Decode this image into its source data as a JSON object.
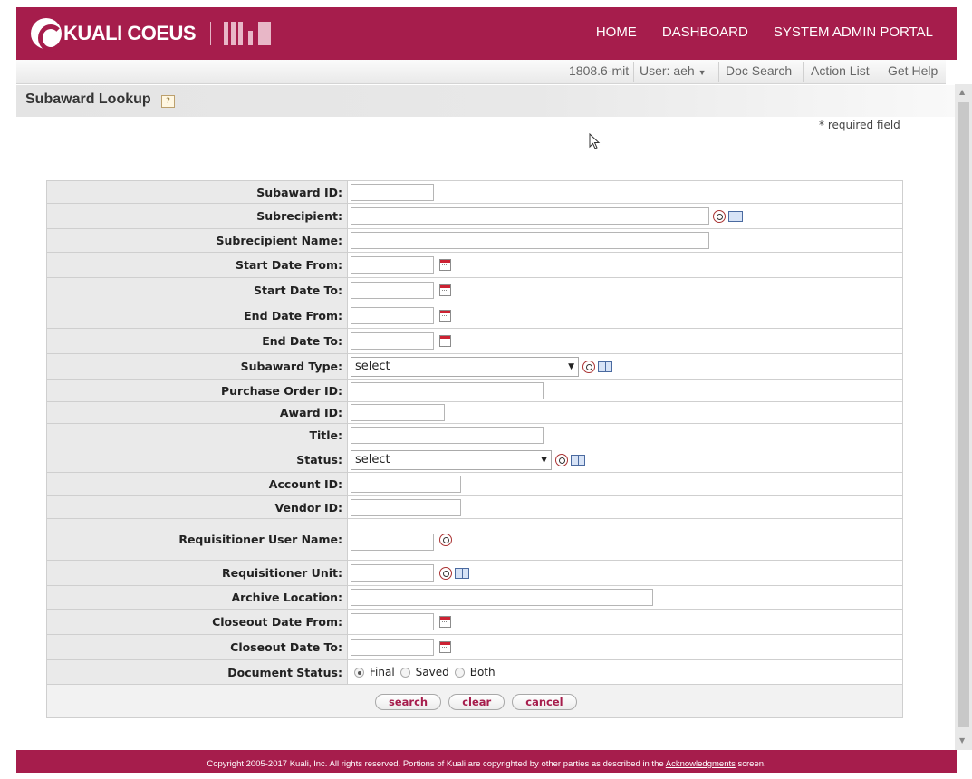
{
  "header": {
    "logo_text": "KUALI COEUS",
    "nav": [
      "HOME",
      "DASHBOARD",
      "SYSTEM ADMIN PORTAL"
    ]
  },
  "subbar": {
    "version": "1808.6-mit",
    "user_label": "User: aeh",
    "items": [
      "Doc Search",
      "Action List",
      "Get Help"
    ]
  },
  "page": {
    "title": "Subaward Lookup",
    "help_icon": "?",
    "required_note": "* required field"
  },
  "form": {
    "subaward_id": "Subaward ID:",
    "subrecipient": "Subrecipient:",
    "subrecipient_name": "Subrecipient Name:",
    "start_date_from": "Start Date From:",
    "start_date_to": "Start Date To:",
    "end_date_from": "End Date From:",
    "end_date_to": "End Date To:",
    "subaward_type": "Subaward Type:",
    "subaward_type_value": "select",
    "purchase_order_id": "Purchase Order ID:",
    "award_id": "Award ID:",
    "title": "Title:",
    "status": "Status:",
    "status_value": "select",
    "account_id": "Account ID:",
    "vendor_id": "Vendor ID:",
    "requisitioner_user_name": "Requisitioner User Name:",
    "requisitioner_unit": "Requisitioner Unit:",
    "archive_location": "Archive Location:",
    "closeout_date_from": "Closeout Date From:",
    "closeout_date_to": "Closeout Date To:",
    "document_status": "Document Status:",
    "document_status_options": [
      "Final",
      "Saved",
      "Both"
    ],
    "document_status_selected": "Final"
  },
  "buttons": {
    "search": "search",
    "clear": "clear",
    "cancel": "cancel"
  },
  "footer": {
    "text": "Copyright 2005-2017 Kuali, Inc. All rights reserved. Portions of Kuali are copyrighted by other parties as described in the",
    "link": "Acknowledgments",
    "suffix": "screen."
  },
  "colors": {
    "brand": "#a61d4c",
    "indicator_arrow": "#1aa383"
  },
  "icons": [
    "magnifier-icon",
    "book-icon",
    "calendar-icon",
    "help-icon",
    "dropdown-arrow-icon",
    "cursor-icon",
    "indicator-arrow-icon"
  ]
}
